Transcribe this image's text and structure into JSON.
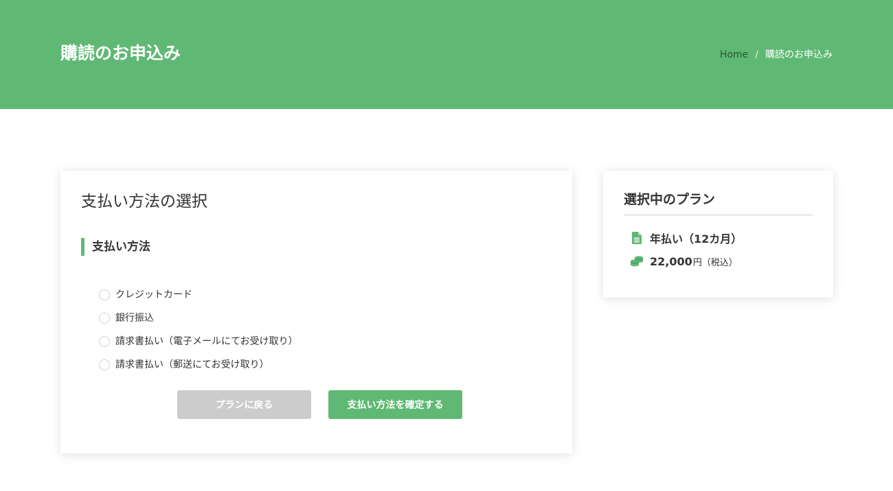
{
  "header": {
    "title": "購読のお申込み",
    "breadcrumb": {
      "home": "Home",
      "separator": "/",
      "current": "購読のお申込み"
    }
  },
  "payment": {
    "title": "支払い方法の選択",
    "section_heading": "支払い方法",
    "options": [
      {
        "label": "クレジットカード"
      },
      {
        "label": "銀行振込"
      },
      {
        "label": "請求書払い（電子メールにてお受け取り）"
      },
      {
        "label": "請求書払い（郵送にてお受け取り）"
      }
    ],
    "back_button": "プランに戻る",
    "confirm_button": "支払い方法を確定する"
  },
  "plan": {
    "title": "選択中のプラン",
    "name": "年払い（12カ月）",
    "price": "22,000",
    "price_unit": "円（税込）",
    "icons": {
      "name": "document-icon",
      "price": "coins-icon"
    }
  },
  "colors": {
    "accent": "#5fb974",
    "disabled_button": "#cccccc",
    "text": "#333333"
  }
}
